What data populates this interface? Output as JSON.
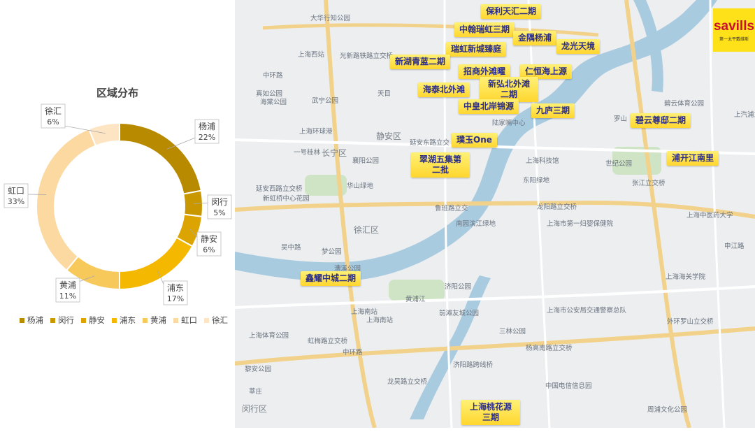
{
  "chart_data": {
    "type": "pie",
    "title": "区域分布",
    "categories": [
      "杨浦",
      "闵行",
      "静安",
      "浦东",
      "黄浦",
      "虹口",
      "徐汇"
    ],
    "values": [
      22,
      5,
      6,
      17,
      11,
      33,
      6
    ],
    "labels": [
      "22%",
      "5%",
      "6%",
      "17%",
      "11%",
      "33%",
      "6%"
    ],
    "colors": [
      "#b88a00",
      "#c99800",
      "#dca400",
      "#f5b800",
      "#f7c85a",
      "#fbd9a0",
      "#fde5c4"
    ],
    "legend_position": "bottom"
  },
  "map": {
    "projects": [
      "保利天汇二期",
      "中翰瑞虹三期",
      "金隅杨浦",
      "龙光天境",
      "瑞虹新城臻庭",
      "新湖青蓝二期",
      "招商外滩曜",
      "仁恒海上源",
      "新弘北外滩二期",
      "海泰北外滩",
      "中皇北岸锦源",
      "九庐三期",
      "碧云尊邸二期",
      "璞玉One",
      "翠湖五集第二批",
      "浦开江南里",
      "鑫耀中城二期",
      "上海桃花源三期"
    ],
    "place_labels": [
      "大华行知公园",
      "上海西站",
      "光新路铁路立交桥",
      "真如公园",
      "海棠公园",
      "武宁公园",
      "上海环球港",
      "一号桂林",
      "静安区",
      "长宁区",
      "天目",
      "延安东路立交",
      "襄阳公园",
      "延安西路立交桥",
      "华山绿地",
      "新虹桥中心花园",
      "东阳绿地",
      "上海科技馆",
      "世纪公园",
      "张江立交桥",
      "龙阳路立交桥",
      "上海市第一妇婴保健院",
      "上海中医药大学",
      "鲁班路立交",
      "南园滨江绿地",
      "吴中路",
      "徐汇区",
      "漕溪公园",
      "济阳公园",
      "上海海关学院",
      "前滩友城公园",
      "三林公园",
      "上海南站",
      "虹梅路立交桥",
      "杨高南路立交桥",
      "济阳路跨线桥",
      "中环路",
      "上海市公安局交通警察总队",
      "外环罗山立交桥",
      "中国电信信息园",
      "龙吴路立交桥",
      "闵行区",
      "周浦文化公园",
      "黎安公园",
      "申江路",
      "碧云体育公园",
      "上汽浦东",
      "罗山",
      "陆家嘴中心",
      "中环路",
      "上海体育公园",
      "上海南站",
      "梦公园",
      "莘庄",
      "黄浦江"
    ],
    "logo_word": "savills",
    "logo_sub": "第一太平戴维斯"
  }
}
